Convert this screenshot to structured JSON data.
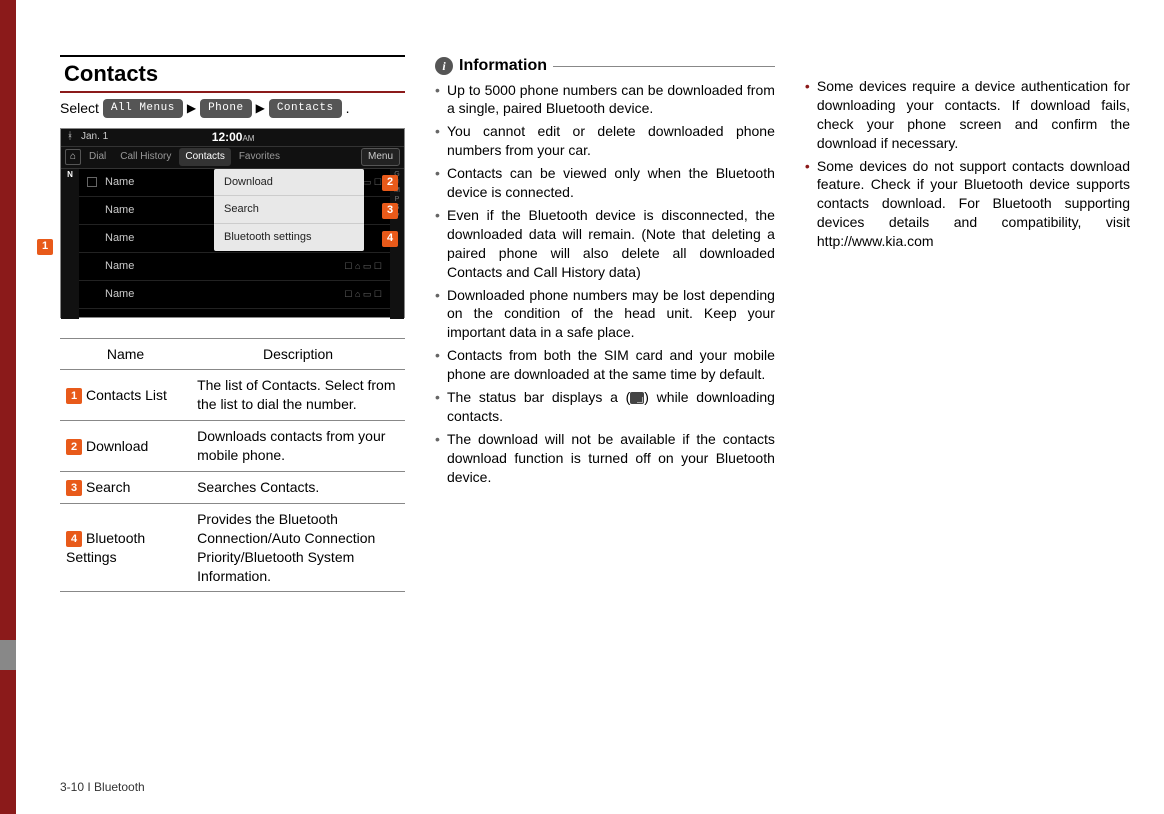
{
  "col1": {
    "title": "Contacts",
    "select_label": "Select",
    "nav": {
      "b1": "All Menus",
      "b2": "Phone",
      "b3": "Contacts"
    },
    "screenshot": {
      "date": "Jan. 1",
      "clock": "12:00",
      "ampm": "AM",
      "tabs": {
        "home": "⌂",
        "t1": "Dial",
        "t2": "Call History",
        "t3": "Contacts",
        "t4": "Favorites",
        "menu": "Menu"
      },
      "row_label": "Name",
      "alpha_active": "N",
      "dd": {
        "i1": "Download",
        "i2": "Search",
        "i3": "Bluetooth settings"
      },
      "right_letters": [
        "G",
        "J",
        "M",
        "P",
        "S",
        "V"
      ]
    },
    "callouts": {
      "n1": "1",
      "n2": "2",
      "n3": "3",
      "n4": "4"
    },
    "table": {
      "h_name": "Name",
      "h_desc": "Description",
      "r1_name": "Contacts List",
      "r1_desc": "The list of Contacts. Select from the list to dial the number.",
      "r2_name": "Download",
      "r2_desc": "Downloads contacts from your mobile phone.",
      "r3_name": "Search",
      "r3_desc": "Searches Contacts.",
      "r4_name": "Bluetooth Settings",
      "r4_desc": "Provides the Bluetooth Connection/Auto Connection Priority/Bluetooth System Information."
    }
  },
  "col2": {
    "info_label": "Information",
    "b1": "Up to 5000 phone numbers can be downloaded from a single, paired Bluetooth device.",
    "b2": "You cannot edit or delete downloaded phone numbers from your car.",
    "b3": "Contacts can be viewed only when the Bluetooth device is connected.",
    "b4": "Even if the Bluetooth device is disconnected, the downloaded data will remain. (Note that deleting a paired phone will also delete all downloaded Contacts and Call History data)",
    "b5": "Downloaded phone numbers may be lost depending on the condition of the head unit. Keep your important data in a safe place.",
    "b6": "Contacts from both the SIM card and your mobile phone are downloaded at the same time by default.",
    "b7a": "The status bar displays a (",
    "b7b": ") while downloading contacts.",
    "b8": "The download will not be available if the contacts download function is turned off on your Bluetooth device."
  },
  "col3": {
    "b1": "Some devices require a device authentication for downloading your contacts. If download fails, check your phone screen and confirm the download if necessary.",
    "b2": "Some devices do not support contacts download feature. Check if your Bluetooth device supports contacts download. For Bluetooth supporting devices details and compatibility, visit http://www.kia.com"
  },
  "footer": "3-10 I Bluetooth"
}
